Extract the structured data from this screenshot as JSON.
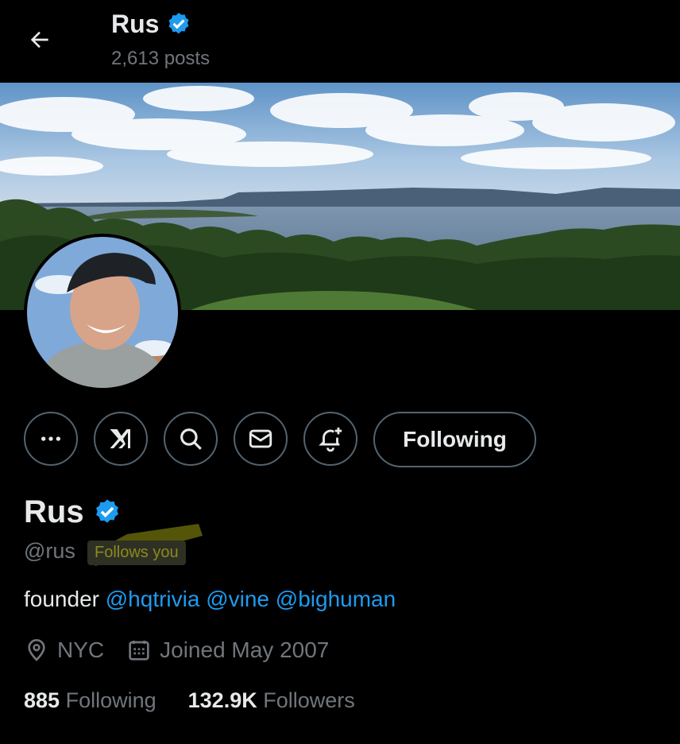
{
  "header": {
    "name": "Rus",
    "posts": "2,613 posts"
  },
  "icons": {
    "back": "arrow-left-icon",
    "verified": "verified-badge-icon",
    "more": "more-icon",
    "grok": "grok-icon",
    "search": "search-icon",
    "message": "envelope-icon",
    "notify": "bell-plus-icon",
    "location": "location-pin-icon",
    "calendar": "calendar-icon"
  },
  "actions": {
    "following_label": "Following"
  },
  "profile": {
    "name": "Rus",
    "handle": "@rus",
    "follows_you": "Follows you",
    "bio_prefix": "founder",
    "bio_mentions": [
      "@hqtrivia",
      "@vine",
      "@bighuman"
    ],
    "location": "NYC",
    "joined": "Joined May 2007"
  },
  "stats": {
    "following_count": "885",
    "following_label": "Following",
    "followers_count": "132.9K",
    "followers_label": "Followers"
  },
  "colors": {
    "background": "#000000",
    "accent": "#1d9bf0",
    "muted": "#71767b",
    "border": "#536471",
    "highlight": "#8a8a20"
  }
}
